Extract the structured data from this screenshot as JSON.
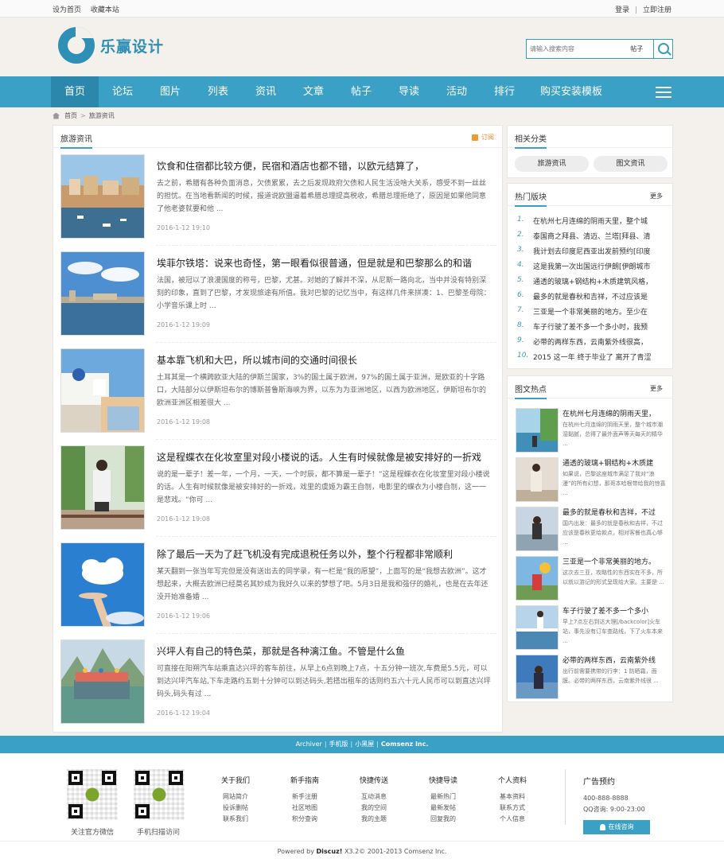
{
  "topbar": {
    "set_home": "设为首页",
    "favorite": "收藏本站",
    "login": "登录",
    "sep": "|",
    "register": "立即注册"
  },
  "logo": {
    "text": "乐赢设计"
  },
  "search": {
    "placeholder": "请输入搜索内容",
    "type": "帖子"
  },
  "nav": {
    "items": [
      "首页",
      "论坛",
      "图片",
      "列表",
      "资讯",
      "文章",
      "帖子",
      "导读",
      "活动",
      "排行",
      "购买安装模板"
    ]
  },
  "breadcrumb": {
    "home": "首页",
    "current": "旅游资讯",
    "sep": ">"
  },
  "main": {
    "title": "旅游资讯",
    "rss": "订阅"
  },
  "articles": [
    {
      "title": "饮食和住宿都比较方便，民宿和酒店也都不错，以欧元结算了，",
      "summary": "去之前，希腊有各种负面消息，欠债累累，去之后发现政府欠债和人民生活没啥大关系，感受不到一丝丝的担忧。在当地看新闻的时候，报道说欧盟逼着希腊总理提高税收，希腊总理拒绝了，原因是如果他同意了他老婆就要和他 ...",
      "date": "2016-1-12 19:10"
    },
    {
      "title": "埃菲尔铁塔：说来也奇怪，第一眼看似很普通，但是就是和巴黎那么的和谐",
      "summary": "法国，被冠以了浪漫国度的称号，巴黎，尤甚。对她的了解并不深，从尼斯一路向北，当中并没有特别深刻的印象，直到了巴黎，才发现旅途有所值。我对巴黎的记忆当中，有这样几件来拼凑：1、巴黎圣母院：小学音乐课上时 ...",
      "date": "2016-1-12 19:09"
    },
    {
      "title": "基本靠飞机和大巴，所以城市间的交通时间很长",
      "summary": "土耳其是一个横跨欧亚大陆的伊斯兰国家，3%的国土属于欧洲，97%的国土属于亚洲，是欧亚的十字路口，大陆部分以伊斯坦布尔的博斯普鲁斯海峡为界，以东为为亚洲地区，以西为欧洲地区，伊斯坦布尔的欧洲亚洲区相差很大 ...",
      "date": "2016-1-12 19:08"
    },
    {
      "title": "这是程蝶衣在化妆室里对段小楼说的话。人生有时候就像是被安排好的一折戏",
      "summary": "说的是一辈子！差一年，一个月，一天，一个时辰，都不算是一辈子！”这是程蝶衣在化妆室里对段小楼说的话。人生有时候就像是被安排好的一折戏，戏里的虞姬为霸王自刎，电影里的蝶衣为小楼自刎，这一一是悲戏。“你可 ...",
      "date": "2016-1-12 19:08"
    },
    {
      "title": "除了最后一天为了赶飞机没有完成退税任务以外，整个行程都非常顺利",
      "summary": "某天翻到一张当年写完但是没有送出去的同学录，有一栏是“我的愿望”，上面写的是“我想去欧洲”。这才想起来，大概去欧洲已经莫名其妙成为我好久以来的梦想了吧。5月3日是我和强仔的婚礼，也是在去年还没开始准备婚 ...",
      "date": "2016-1-12 19:06"
    },
    {
      "title": "兴坪人有自己的特色菜，那就是各种漓江鱼。不管是什么鱼",
      "summary": "可直接在阳朔汽车站乘直达兴坪的客车前往，从早上6点到晚上7点，十五分钟一班次,车费是5.5元，可以到达兴坪汽车站,下车走路约五到十分钟可以到达码头,若搭出租车的话则约五六十元人民币可以到直达兴坪码头,码头有过 ...",
      "date": "2016-1-12 19:04"
    }
  ],
  "categories": {
    "title": "相关分类",
    "items": [
      "旅游资讯",
      "图文资讯"
    ]
  },
  "hot": {
    "title": "热门版块",
    "more": "更多",
    "items": [
      "在杭州七月连绵的阴雨天里，整个城",
      "泰国商之拜县、清迈、兰塔[拜县、清",
      "我计划去印度尼西亚出发前预约[印度",
      "这是我第一次出国远行伊朗[伊朗城市",
      "通透的玻璃+钢结构+木质建筑风格，",
      "最多的就是春秋和吉祥，不过应该是",
      "三亚是一个非常美丽的地方。至少在",
      "车子行驶了差不多一个多小时，我预",
      "必带的两样东西，云南紫外线很高，",
      "2015 这一年 终于毕业了 离开了青涩"
    ]
  },
  "pics": {
    "title": "图文热点",
    "more": "更多",
    "items": [
      {
        "title": "在杭州七月连绵的阴雨天里，",
        "summary": "在杭州七月连绵的阴雨天里，整个城市潮湿黏腻，总得了最外面声等天每天的精华 ..."
      },
      {
        "title": "通透的玻璃+钢结构+木质建",
        "summary": "如果说，巴黎这座城市满足了我对“浪漫”的所有幻想，那哥本哈根带给我的惊喜 ..."
      },
      {
        "title": "最多的就是春秋和吉祥，不过",
        "summary": "国内出发：最多的就是春秋和吉祥，不过应该是春秋更给款点，相对客餐也真心够 ..."
      },
      {
        "title": "三亚是一个非常美丽的地方。",
        "summary": "这次去三亚，攻略性的东西实在不多，所以就以游记的形式呈现给大家。主要是 ..."
      },
      {
        "title": "车子行驶了差不多一个多小",
        "summary": "早上7点左右到达大理[/backcolor]火车站，事先没有订车查路线，下了火车本来 ..."
      },
      {
        "title": "必带的两样东西，云南紫外线",
        "summary": "出行前需要携带的行李：1 防晒霜，面膜。必带的两样东西，云南紫外线很 ..."
      }
    ]
  },
  "footer_bar": {
    "archiver": "Archiver",
    "sep": "|",
    "mobile": "手机版",
    "darkroom": "小黑屋",
    "company": "Comsenz Inc."
  },
  "footer": {
    "qr": [
      {
        "caption": "关注官方微信"
      },
      {
        "caption": "手机扫描访问"
      }
    ],
    "cols": [
      {
        "head": "关于我们",
        "items": [
          "网站简介",
          "投诉删帖",
          "联系我们"
        ]
      },
      {
        "head": "新手指南",
        "items": [
          "新手注册",
          "社区地图",
          "积分查询"
        ]
      },
      {
        "head": "快捷传送",
        "items": [
          "互动消息",
          "我的空间",
          "我的主题"
        ]
      },
      {
        "head": "快捷导读",
        "items": [
          "最新热门",
          "最新发帖",
          "回复我的"
        ]
      },
      {
        "head": "个人资料",
        "items": [
          "基本资料",
          "联系方式",
          "个人信息"
        ]
      }
    ],
    "ad": {
      "title": "广告预约",
      "phone": "400-888-8888",
      "qq": "QQ咨询: 9:00-23:00",
      "button": "在线咨询"
    },
    "copy_powered": "Powered by",
    "copy_brand": "Discuz!",
    "copy_rest": "X3.2© 2001-2013 Comsenz Inc."
  },
  "colors": {
    "accent": "#3aa0c6",
    "nav_active": "#2b87ab",
    "rss": "#e88424"
  }
}
